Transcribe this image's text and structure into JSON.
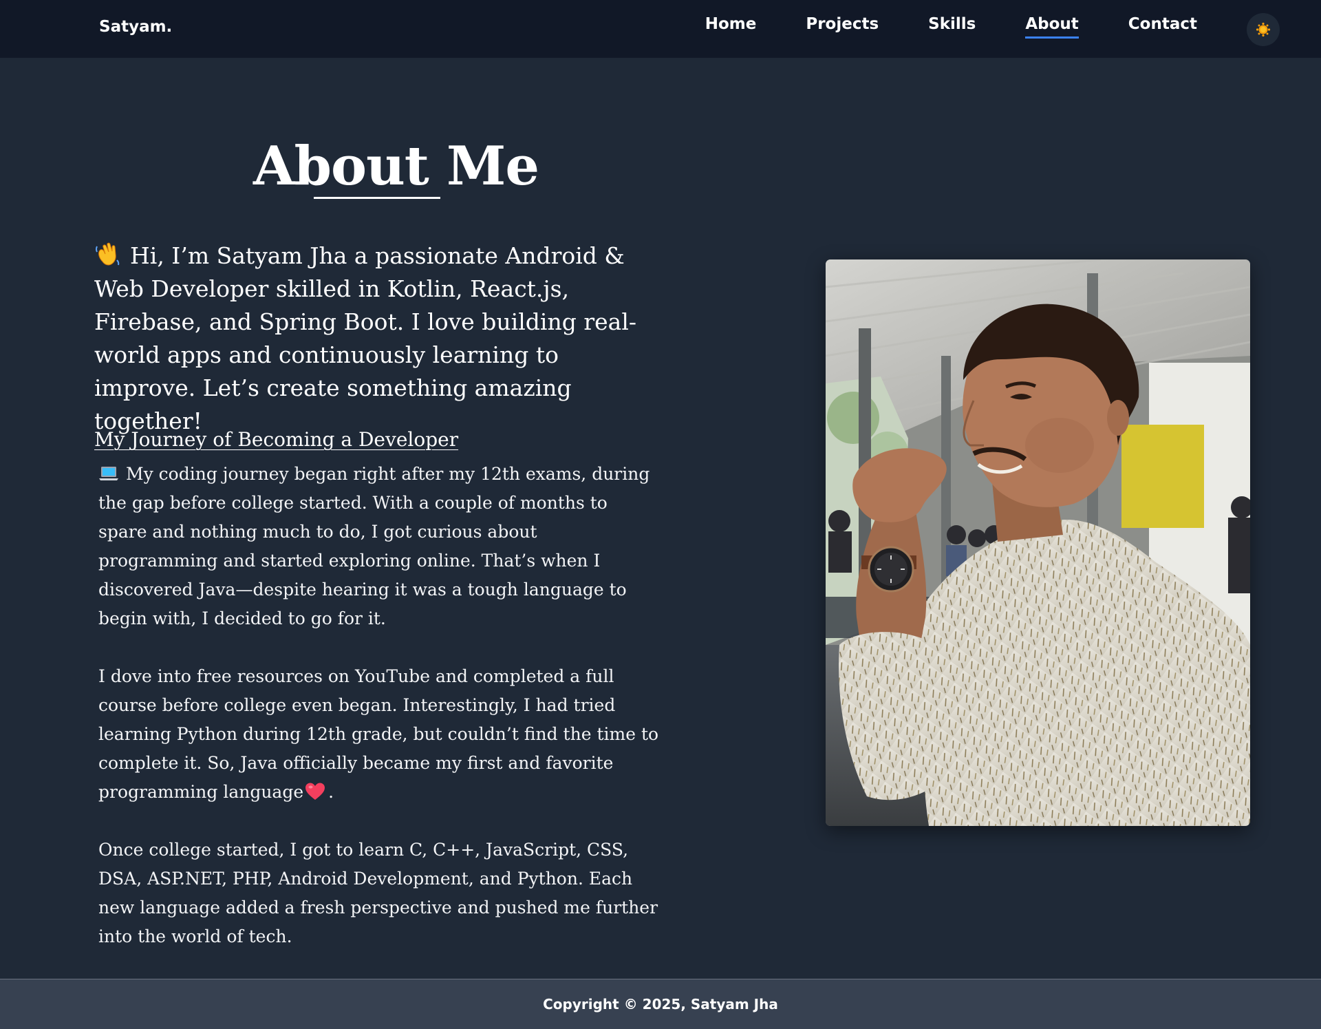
{
  "brand": "Satyam.",
  "nav": {
    "items": [
      {
        "label": "Home",
        "active": false
      },
      {
        "label": "Projects",
        "active": false
      },
      {
        "label": "Skills",
        "active": false
      },
      {
        "label": "About",
        "active": true
      },
      {
        "label": "Contact",
        "active": false
      }
    ],
    "theme_toggle_icon": "sun-icon"
  },
  "about": {
    "title": "About Me",
    "intro_emoji": "waving-hand-icon",
    "intro": "Hi, I’m Satyam Jha a passionate Android & Web Developer skilled in Kotlin, React.js, Firebase, and Spring Boot. I love building real-world apps and continuously learning to improve. Let’s create something amazing together!",
    "journey_heading": "My Journey of Becoming a Developer",
    "journey": {
      "p1_emoji": "laptop-icon",
      "p1": "My coding journey began right after my 12th exams, during the gap before college started. With a couple of months to spare and nothing much to do, I got curious about programming and started exploring online. That’s when I discovered Java—despite hearing it was a tough language to begin with, I decided to go for it.",
      "p2": "I dove into free resources on YouTube and completed a full course before college even began. Interestingly, I had tried learning Python during 12th grade, but couldn’t find the time to complete it. So, Java officially became my first and favorite programming language",
      "p2_emoji": "heart-icon",
      "p2_end": ".",
      "p3": "Once college started, I got to learn C, C++, JavaScript, CSS, DSA, ASP.NET, PHP, Android Development, and Python. Each new language added a fresh perspective and pushed me further into the world of tech."
    },
    "photo_alt": "profile-photo"
  },
  "footer": {
    "copyright": "Copyright © 2025, Satyam Jha"
  },
  "colors": {
    "page_bg": "#1f2937",
    "navbar_bg": "#111827",
    "footer_bg": "#374151",
    "accent": "#3b82f6",
    "sun": "#f59e0b"
  }
}
